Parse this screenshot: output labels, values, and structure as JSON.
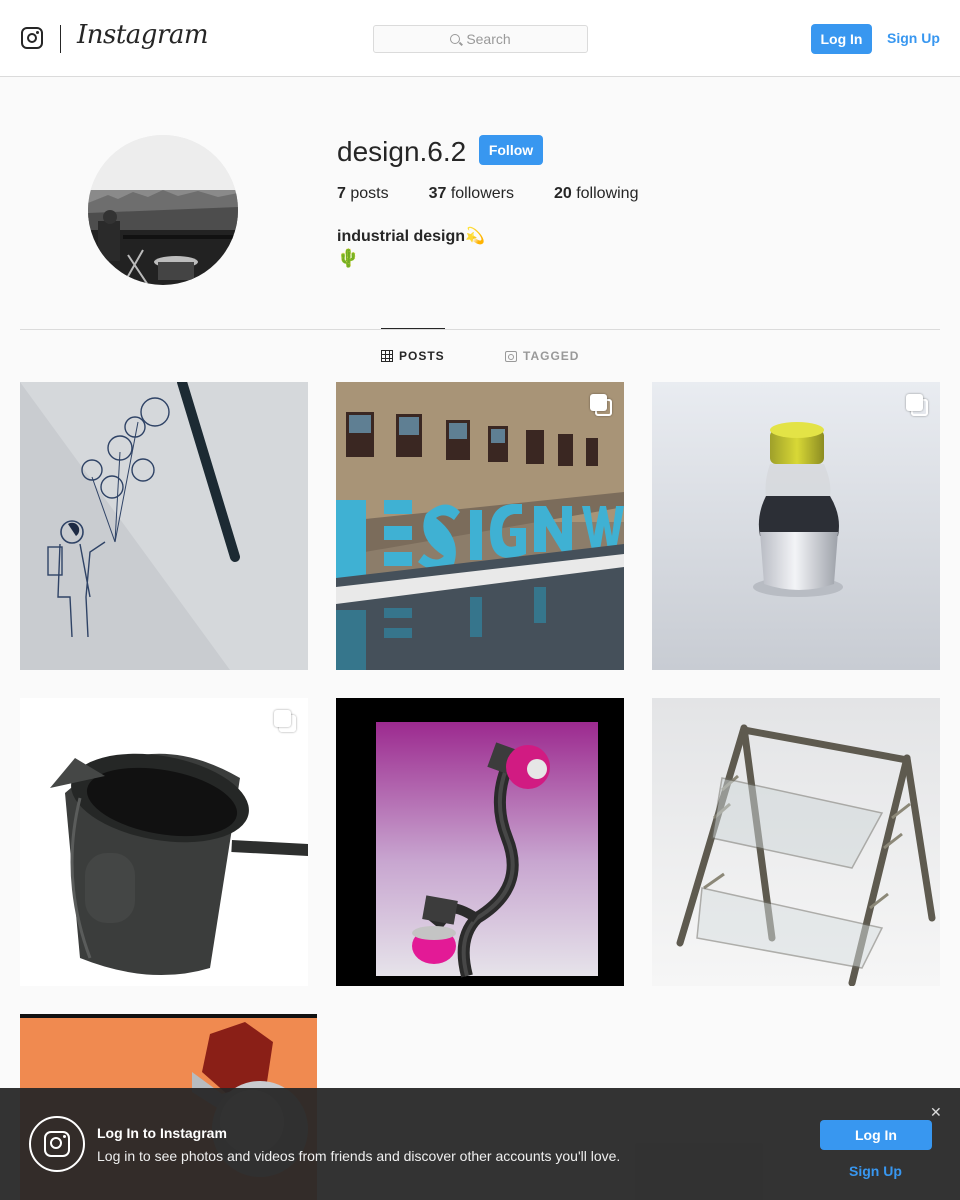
{
  "header": {
    "wordmark": "Instagram",
    "search_placeholder": "Search",
    "login_label": "Log In",
    "signup_label": "Sign Up"
  },
  "profile": {
    "username": "design.6.2",
    "follow_label": "Follow",
    "stats": {
      "posts_count": "7",
      "posts_label": " posts",
      "followers_count": "37",
      "followers_label": " followers",
      "following_count": "20",
      "following_label": " following"
    },
    "bio_name": "industrial design💫",
    "bio_line2": "🌵"
  },
  "tabs": [
    {
      "label": "POSTS",
      "icon": "grid-icon",
      "active": true
    },
    {
      "label": "TAGGED",
      "icon": "tag-icon",
      "active": false
    }
  ],
  "posts": [
    {
      "subject": "astronaut-with-balloons-sketch",
      "multi": false
    },
    {
      "subject": "design-week-letters",
      "multi": true
    },
    {
      "subject": "bottle-render",
      "multi": true
    },
    {
      "subject": "black-pitcher-render",
      "multi": true
    },
    {
      "subject": "pink-lamp-render",
      "multi": false
    },
    {
      "subject": "wire-rack-render",
      "multi": false
    },
    {
      "subject": "orange-render",
      "multi": false
    }
  ],
  "banner": {
    "title": "Log In to Instagram",
    "text": "Log in to see photos and videos from friends and discover other accounts you'll love.",
    "login_label": "Log In",
    "signup_label": "Sign Up",
    "close_glyph": "✕"
  },
  "colors": {
    "accent": "#3897f0",
    "background": "#fafafa",
    "border": "#dbdbdb",
    "text": "#262626"
  }
}
